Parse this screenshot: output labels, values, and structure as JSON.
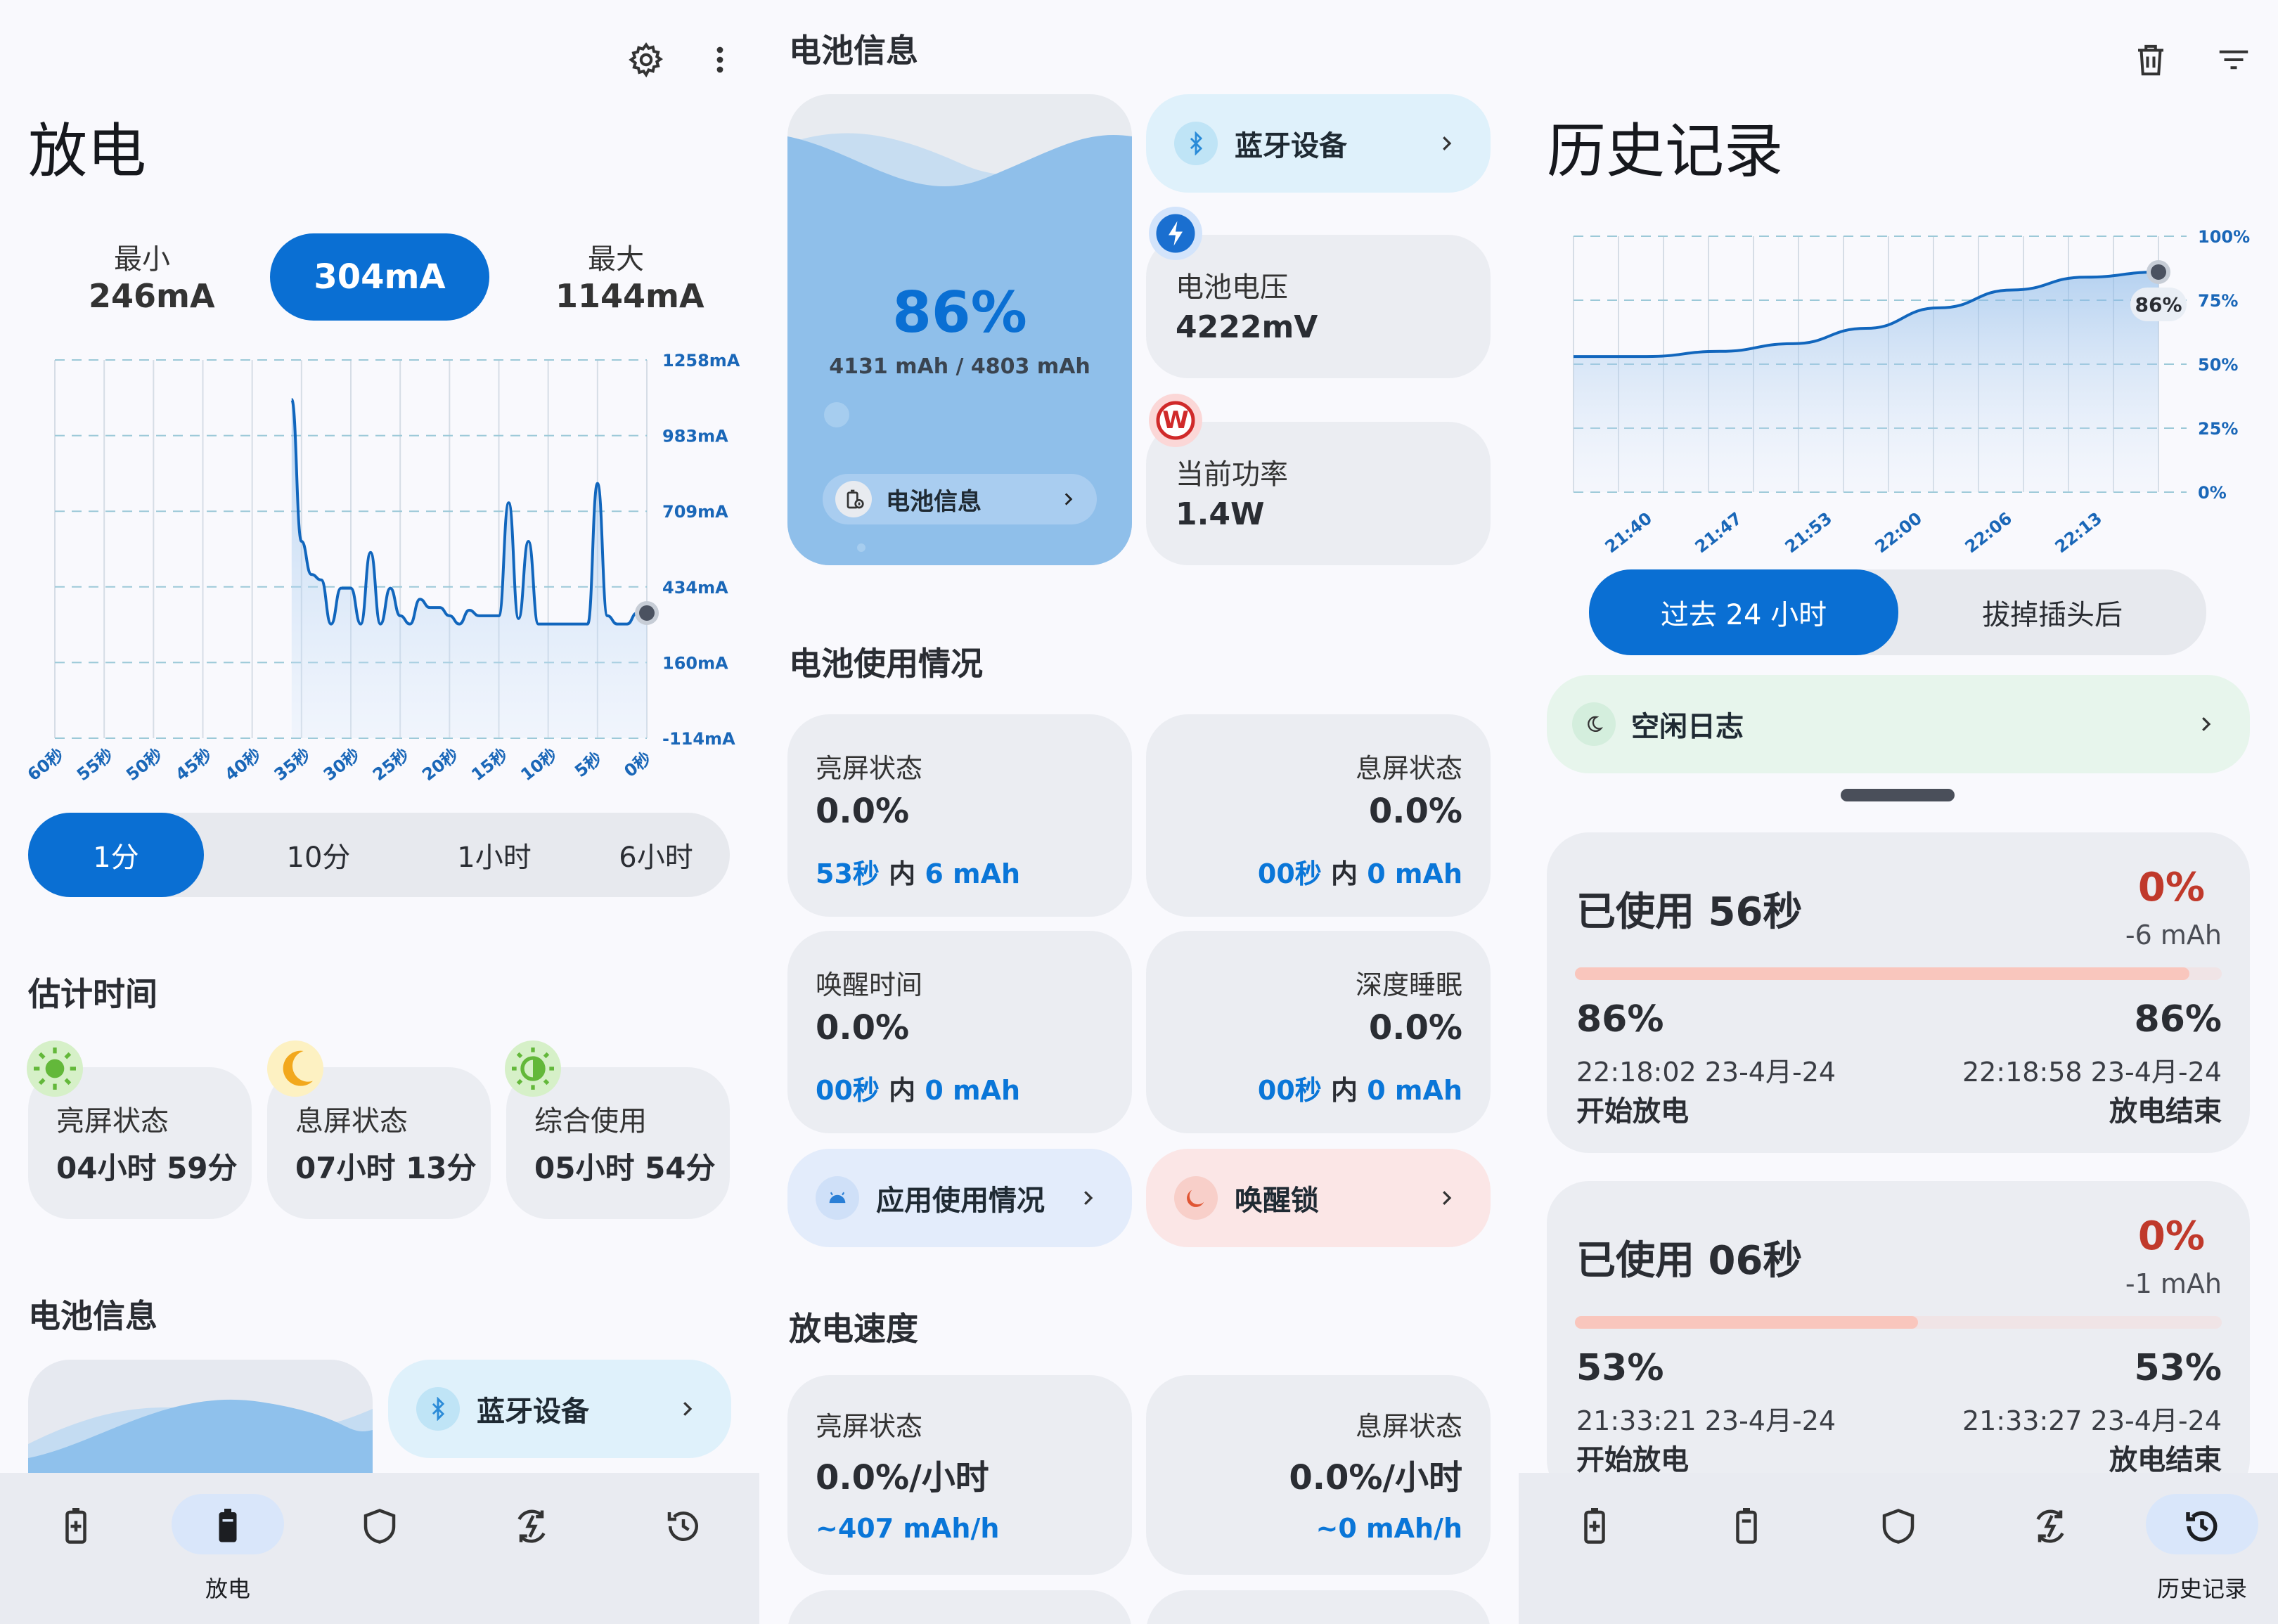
{
  "discharge": {
    "title": "放电",
    "min_label": "最小",
    "min_value": "246mA",
    "current_value": "304mA",
    "max_label": "最大",
    "max_value": "1144mA",
    "y_ticks": [
      "1258mA",
      "983mA",
      "709mA",
      "434mA",
      "160mA",
      "-114mA"
    ],
    "x_ticks": [
      "60秒",
      "55秒",
      "50秒",
      "45秒",
      "40秒",
      "35秒",
      "30秒",
      "25秒",
      "20秒",
      "15秒",
      "10秒",
      "5秒",
      "0秒"
    ],
    "range_tabs": [
      "1分",
      "10分",
      "1小时",
      "6小时"
    ],
    "estimate_title": "估计时间",
    "estimates": [
      {
        "label": "亮屏状态",
        "value": "04小时 59分"
      },
      {
        "label": "息屏状态",
        "value": "07小时 13分"
      },
      {
        "label": "综合使用",
        "value": "05小时 54分"
      }
    ],
    "battery_info_title": "电池信息",
    "bluetooth_label": "蓝牙设备"
  },
  "chart_data": [
    {
      "type": "area",
      "title": "",
      "xlabel": "",
      "ylabel": "",
      "ylim": [
        -114,
        1258
      ],
      "x": [
        36,
        35,
        34,
        33,
        32,
        31,
        30,
        29,
        28,
        27,
        26,
        25,
        24,
        23,
        22,
        21,
        20,
        19,
        18,
        17,
        16,
        15,
        14,
        13,
        12,
        11,
        10,
        9,
        8,
        7,
        6,
        5,
        4,
        3,
        2,
        1,
        0
      ],
      "y": [
        1115,
        600,
        480,
        460,
        300,
        430,
        430,
        300,
        560,
        300,
        430,
        330,
        300,
        390,
        360,
        360,
        330,
        300,
        350,
        330,
        330,
        330,
        740,
        320,
        600,
        300,
        300,
        300,
        300,
        300,
        300,
        810,
        330,
        300,
        300,
        340,
        340
      ],
      "series": [
        {
          "values": [
            1115,
            600,
            480,
            460,
            300,
            430,
            430,
            300,
            560,
            300,
            430,
            330,
            300,
            390,
            360,
            360,
            330,
            300,
            350,
            330,
            330,
            330,
            740,
            320,
            600,
            300,
            300,
            300,
            300,
            300,
            300,
            810,
            330,
            300,
            300,
            340,
            340
          ]
        }
      ]
    },
    {
      "type": "area",
      "title": "",
      "xlabel": "",
      "ylabel": "",
      "ylim": [
        0,
        100
      ],
      "x": [
        "21:40",
        "21:47",
        "21:53",
        "22:00",
        "22:06",
        "22:13"
      ],
      "values": [
        53,
        53,
        55,
        58,
        64,
        72,
        79,
        84,
        86
      ],
      "current_label": "86%"
    }
  ],
  "battery": {
    "section_title": "电池信息",
    "percent": "86%",
    "capacity": "4131 mAh / 4803 mAh",
    "info_button": "电池信息",
    "bluetooth_label": "蓝牙设备",
    "voltage_label": "电池电压",
    "voltage_value": "4222mV",
    "power_label": "当前功率",
    "power_value": "1.4W",
    "power_badge": "W"
  },
  "usage": {
    "title": "电池使用情况",
    "cards": [
      {
        "label": "亮屏状态",
        "value": "0.0%",
        "detail_time": "53秒",
        "detail_mid": " 内 ",
        "detail_mah": "6 mAh"
      },
      {
        "label": "息屏状态",
        "value": "0.0%",
        "detail_time": "00秒",
        "detail_mid": " 内 ",
        "detail_mah": "0 mAh"
      },
      {
        "label": "唤醒时间",
        "value": "0.0%",
        "detail_time": "00秒",
        "detail_mid": " 内 ",
        "detail_mah": "0 mAh"
      },
      {
        "label": "深度睡眠",
        "value": "0.0%",
        "detail_time": "00秒",
        "detail_mid": " 内 ",
        "detail_mah": "0 mAh"
      }
    ],
    "app_usage_label": "应用使用情况",
    "wakelock_label": "唤醒锁"
  },
  "speed": {
    "title": "放电速度",
    "cards": [
      {
        "label": "亮屏状态",
        "value": "0.0%/小时",
        "detail": "~407 mAh/h"
      },
      {
        "label": "息屏状态",
        "value": "0.0%/小时",
        "detail": "~0 mAh/h"
      }
    ]
  },
  "history": {
    "title": "历史记录",
    "y_ticks": [
      "100%",
      "75%",
      "50%",
      "25%",
      "0%"
    ],
    "range_tabs": [
      "过去 24 小时",
      "拔掉插头后"
    ],
    "idle_log_label": "空闲日志",
    "sessions": [
      {
        "used": "已使用 56秒",
        "percent_change": "0%",
        "mah": "-6 mAh",
        "progress": 0.95,
        "start_pct": "86%",
        "start_time": "22:18:02 23-4月-24",
        "start_label": "开始放电",
        "end_pct": "86%",
        "end_time": "22:18:58 23-4月-24",
        "end_label": "放电结束"
      },
      {
        "used": "已使用 06秒",
        "percent_change": "0%",
        "mah": "-1 mAh",
        "progress": 0.53,
        "start_pct": "53%",
        "start_time": "21:33:21 23-4月-24",
        "start_label": "开始放电",
        "end_pct": "53%",
        "end_time": "21:33:27 23-4月-24",
        "end_label": "放电结束"
      }
    ]
  },
  "nav": {
    "discharge_label": "放电",
    "history_label": "历史记录"
  },
  "colors": {
    "primary": "#0a6fd3",
    "accent_red": "#c0392b",
    "bluetooth_bg": "#dff1fb",
    "wakelock_bg": "#fbe6e6",
    "app_usage_bg": "#e3ecfb",
    "idle_bg": "#e7f5ec"
  }
}
